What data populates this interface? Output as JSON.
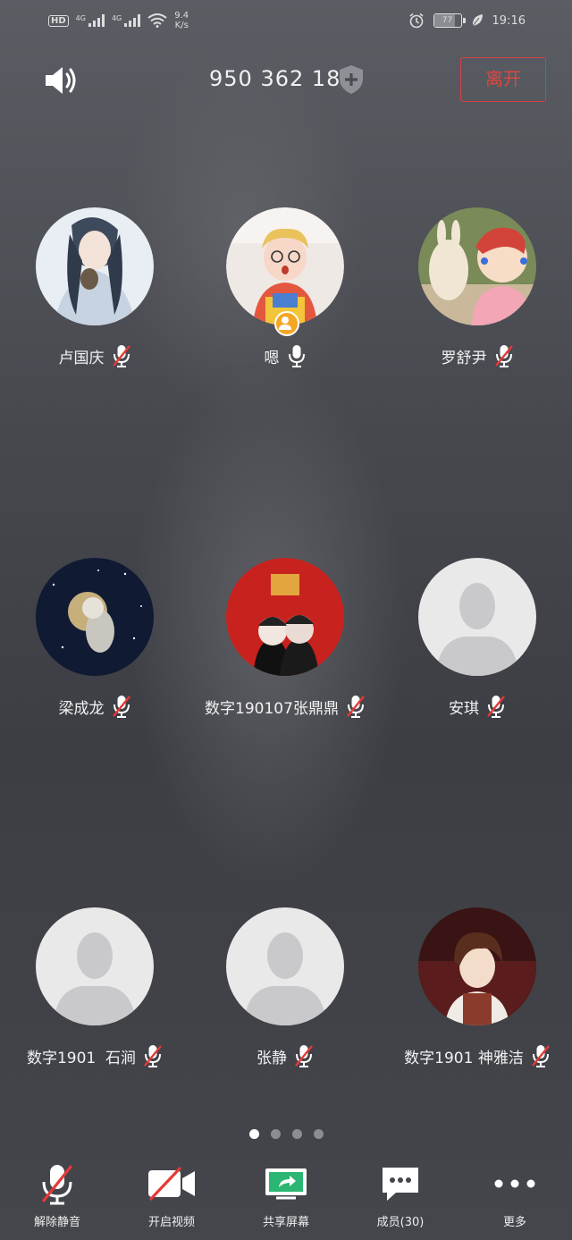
{
  "status_bar": {
    "hd": "HD",
    "signal1": "4G",
    "signal2": "4G",
    "speed_value": "9.4",
    "speed_unit": "K/s",
    "battery": "77",
    "time": "19:16"
  },
  "header": {
    "meeting_id": "950 362 186",
    "leave_label": "离开"
  },
  "participants": [
    {
      "name": "卢国庆",
      "mic": "muted"
    },
    {
      "name": "嗯",
      "mic": "on"
    },
    {
      "name": "罗舒尹",
      "mic": "muted"
    },
    {
      "name": "梁成龙",
      "mic": "muted"
    },
    {
      "name": "数字190107张鼎鼎",
      "mic": "muted"
    },
    {
      "name": "安琪",
      "mic": "muted"
    },
    {
      "name": "数字1901  石涧",
      "mic": "muted"
    },
    {
      "name": "张静",
      "mic": "muted"
    },
    {
      "name": "数字1901 神雅洁",
      "mic": "muted"
    }
  ],
  "pager": {
    "total": 4,
    "active": 1
  },
  "toolbar": {
    "unmute": "解除静音",
    "video": "开启视频",
    "share": "共享屏幕",
    "members": "成员(30)",
    "more": "更多"
  },
  "colors": {
    "leave": "#e2453f",
    "share_green": "#2bb673",
    "muted_red": "#e53935",
    "host_badge": "#f5a623"
  }
}
